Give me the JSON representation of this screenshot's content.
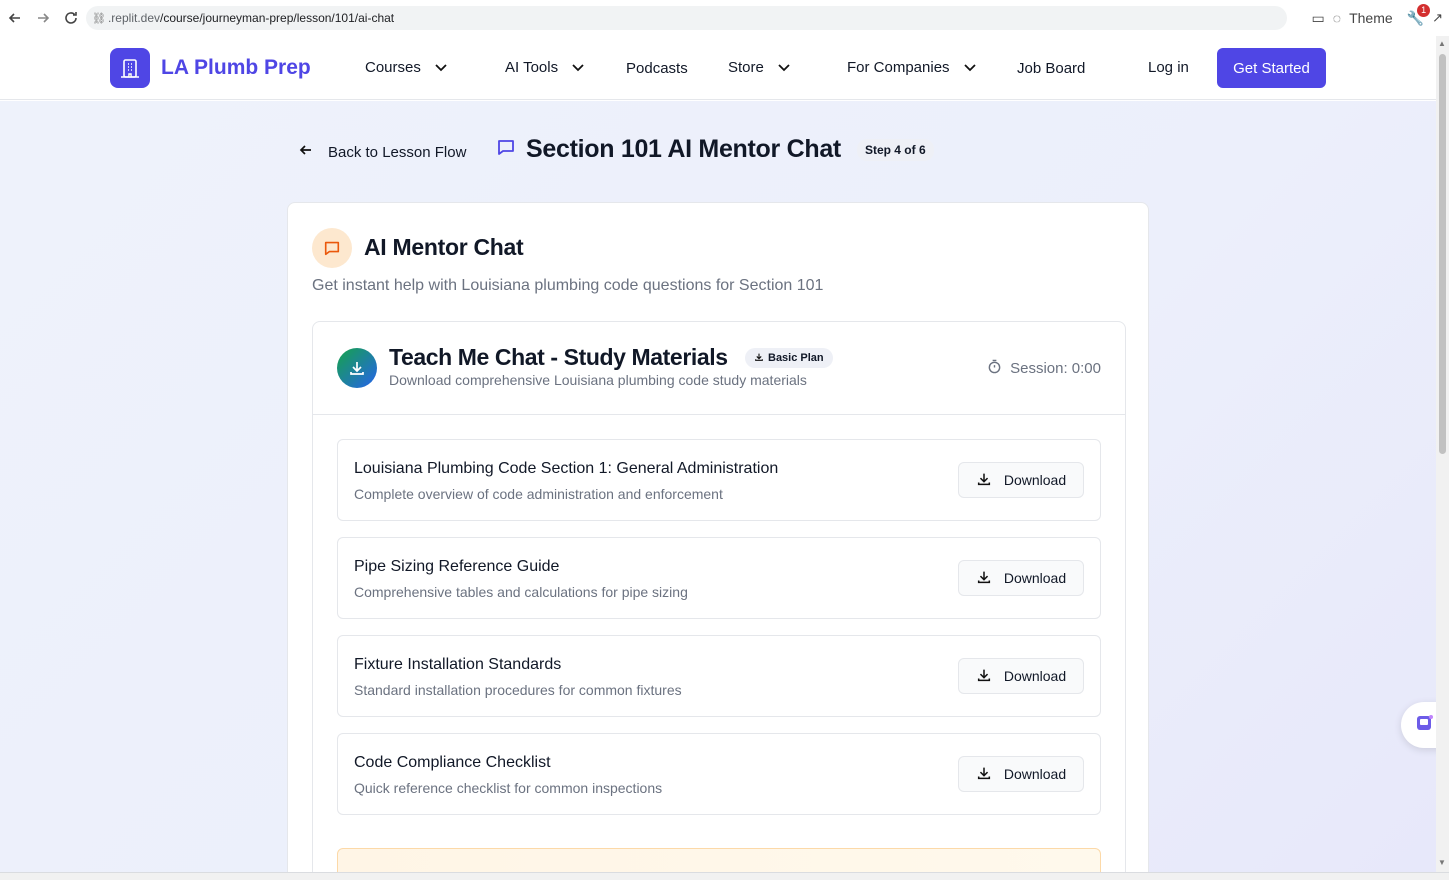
{
  "browser": {
    "url_host": ".replit.dev",
    "url_path": "/course/journeyman-prep/lesson/101/ai-chat",
    "theme_label": "Theme",
    "notification_count": "1"
  },
  "header": {
    "brand": "LA Plumb Prep",
    "nav": {
      "courses": "Courses",
      "ai_tools": "AI Tools",
      "podcasts": "Podcasts",
      "store": "Store",
      "for_companies": "For Companies",
      "job_board": "Job Board",
      "login": "Log in"
    },
    "cta": "Get Started",
    "brand_color": "#4f46e5"
  },
  "page": {
    "back_label": "Back to Lesson Flow",
    "title": "Section 101 AI Mentor Chat",
    "step": "Step 4 of 6"
  },
  "card": {
    "title": "AI Mentor Chat",
    "subtitle": "Get instant help with Louisiana plumbing code questions for Section 101"
  },
  "materials": {
    "title": "Teach Me Chat - Study Materials",
    "plan_badge": "Basic Plan",
    "subtitle": "Download comprehensive Louisiana plumbing code study materials",
    "session": "Session: 0:00",
    "items": [
      {
        "title": "Louisiana Plumbing Code Section 1: General Administration",
        "desc": "Complete overview of code administration and enforcement",
        "button": "Download"
      },
      {
        "title": "Pipe Sizing Reference Guide",
        "desc": "Comprehensive tables and calculations for pipe sizing",
        "button": "Download"
      },
      {
        "title": "Fixture Installation Standards",
        "desc": "Standard installation procedures for common fixtures",
        "button": "Download"
      },
      {
        "title": "Code Compliance Checklist",
        "desc": "Quick reference checklist for common inspections",
        "button": "Download"
      }
    ]
  },
  "icons": {
    "back": "arrow-left-icon",
    "chat": "message-square-icon",
    "download": "download-icon",
    "timer": "timer-icon",
    "logo": "building-icon"
  }
}
